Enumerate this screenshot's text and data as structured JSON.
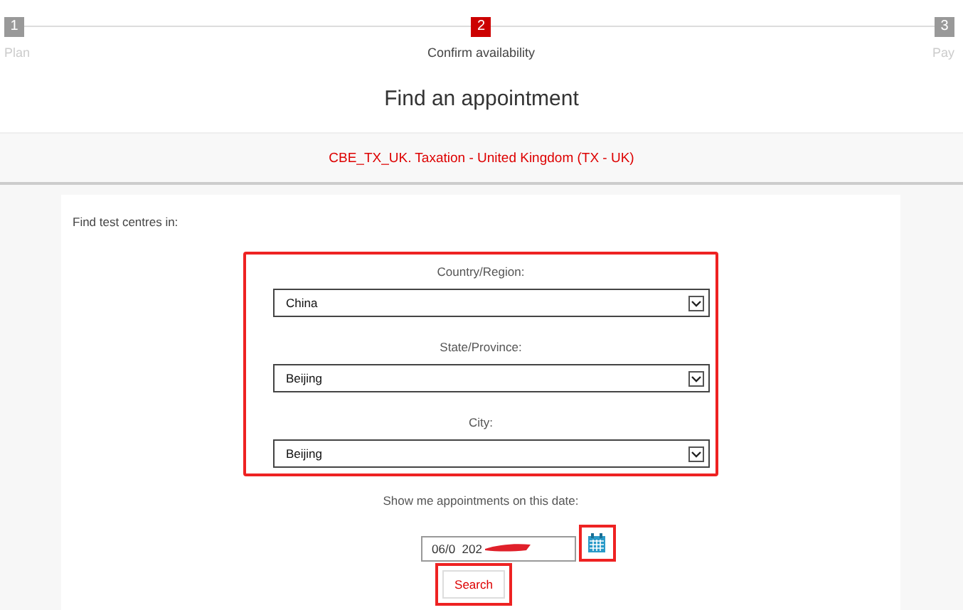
{
  "steps": [
    {
      "number": "1",
      "label": "Plan",
      "selected": false
    },
    {
      "number": "2",
      "label": "Confirm availability",
      "selected": true
    },
    {
      "number": "3",
      "label": "Pay",
      "selected": false
    }
  ],
  "title": "Find an appointment",
  "exam": "CBE_TX_UK. Taxation - United Kingdom (TX - UK)",
  "intro": "Find test centres in:",
  "location_fields": [
    {
      "label": "Country/Region:",
      "value": "China"
    },
    {
      "label": "State/Province:",
      "value": "Beijing"
    },
    {
      "label": "City:",
      "value": "Beijing"
    }
  ],
  "date_label": "Show me appointments on this date:",
  "date_value": "06/0  202",
  "search_button": "Search"
}
